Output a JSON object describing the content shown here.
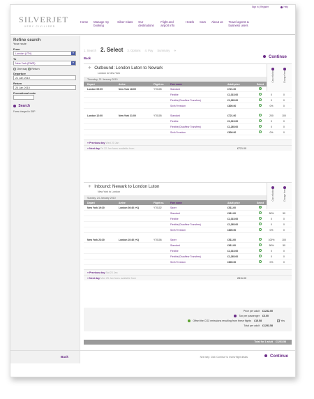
{
  "top_links": {
    "sign_in": "Sign in",
    "register": "Register",
    "help": "Help"
  },
  "logo": {
    "brand": "SILVERJET",
    "tagline": "VERY CIVILISED"
  },
  "nav": [
    "Home",
    "Manage my booking",
    "Silver Class",
    "Our destinations",
    "Flight and airport info",
    "Hotels",
    "Cars",
    "About us",
    "Travel agents & business users"
  ],
  "sidebar": {
    "title": "Refine search",
    "subtitle": "Your route",
    "from_label": "From",
    "from_value": "London (LTN)",
    "to_label": "To",
    "to_value": "New York (EWR)",
    "one_way": "One way",
    "return": "Return",
    "departure_label": "Departure",
    "departure_value": "21 Jan 2010",
    "return_label": "Return",
    "return_value": "24 Jan 2010",
    "promo_label": "Promotional code",
    "search": "Search",
    "note": "Fares charged in GBP"
  },
  "steps": [
    "1. Search",
    "2. Select",
    "3. Options",
    "4. Pay",
    "Summary"
  ],
  "back": "Back",
  "continue": "Continue",
  "columns": [
    "Depart",
    "Arrive",
    "Flight no.",
    "Fare name",
    "Adult price",
    "Select"
  ],
  "side_labels": {
    "cancellation": "Cancellation",
    "change_fees": "Change fees"
  },
  "outbound": {
    "title": "Outbound: London Luton to Newark",
    "subtitle": "London to New York",
    "date": "Thursday, 21 January 2010",
    "flights": [
      {
        "depart": "London  09:09",
        "arrive": "New York  18:09",
        "flight": "Y70105",
        "fares": [
          {
            "name": "Standard",
            "price": "£721.00",
            "selected": true,
            "cancel": "200",
            "change": "100"
          },
          {
            "name": "Flexible",
            "price": "£1,015.00",
            "selected": false,
            "cancel": "0",
            "change": "0"
          },
          {
            "name": "Flexible(Chauffeur Transfers)",
            "price": "£1,265.00",
            "selected": false,
            "cancel": "0",
            "change": "0"
          },
          {
            "name": "Sixth Freedom",
            "price": "£800.00",
            "selected": false,
            "cancel": "0%",
            "change": "0"
          }
        ]
      },
      {
        "depart": "London  12:00",
        "arrive": "New York  21:00",
        "flight": "Y70105",
        "fares": [
          {
            "name": "Standard",
            "price": "£721.00",
            "selected": false,
            "cancel": "200",
            "change": "100"
          },
          {
            "name": "Flexible",
            "price": "£1,015.00",
            "selected": false,
            "cancel": "0",
            "change": "0"
          },
          {
            "name": "Flexible(Chauffeur Transfers)",
            "price": "£1,265.00",
            "selected": false,
            "cancel": "0",
            "change": "0"
          },
          {
            "name": "Sixth Freedom",
            "price": "£800.00",
            "selected": false,
            "cancel": "0%",
            "change": "0"
          }
        ]
      }
    ],
    "prev_day": "« Previous day",
    "prev_day_date": "Wed 20 Jan",
    "next_day": "» Next day",
    "next_day_note": "Fri 22 Jan  fares available from",
    "next_day_price": "£721.00"
  },
  "inbound": {
    "title": "Inbound: Newark to London Luton",
    "subtitle": "New York to London",
    "date": "Sunday, 24 January 2010",
    "flights": [
      {
        "depart": "New York  19:30",
        "arrive": "London  06:40 (+1)",
        "flight": "Y70102",
        "fares": [
          {
            "name": "Saver",
            "price": "£511.00",
            "selected": true,
            "cancel": "100%",
            "change": "100"
          },
          {
            "name": "Standard",
            "price": "£611.00",
            "selected": false,
            "cancel": "50%",
            "change": "50"
          },
          {
            "name": "Flexible",
            "price": "£1,015.00",
            "selected": false,
            "cancel": "0",
            "change": "0"
          },
          {
            "name": "Flexible(Chauffeur Transfers)",
            "price": "£1,265.00",
            "selected": false,
            "cancel": "0",
            "change": "0"
          },
          {
            "name": "Sixth Freedom",
            "price": "£800.00",
            "selected": false,
            "cancel": "0%",
            "change": "0"
          }
        ]
      },
      {
        "depart": "New York  23:30",
        "arrive": "London  10:40 (+1)",
        "flight": "Y70106",
        "fares": [
          {
            "name": "Saver",
            "price": "£511.00",
            "selected": false,
            "cancel": "100%",
            "change": "100"
          },
          {
            "name": "Standard",
            "price": "£611.00",
            "selected": false,
            "cancel": "50%",
            "change": "50"
          },
          {
            "name": "Flexible",
            "price": "£1,015.00",
            "selected": false,
            "cancel": "0",
            "change": "0"
          },
          {
            "name": "Flexible(Chauffeur Transfers)",
            "price": "£1,265.00",
            "selected": false,
            "cancel": "0",
            "change": "0"
          },
          {
            "name": "Sixth Freedom",
            "price": "£800.00",
            "selected": false,
            "cancel": "0%",
            "change": "0"
          }
        ]
      }
    ],
    "prev_day": "« Previous day",
    "prev_day_date": "Sat 23 Jan",
    "next_day": "» Next day",
    "next_day_note": "Mon 25 Jan  fares available from",
    "next_day_price": "£511.00"
  },
  "totals": {
    "price_per_adult_label": "Price per adult",
    "price_per_adult": "£1232.00",
    "tax_label": "Tax per passenger",
    "tax": "£6.00",
    "offset_label": "Offset the CO2 emissions resulting from these flights",
    "offset": "£15.58",
    "offset_yes": "Yes",
    "total_adult_label": "Total per adult",
    "total_adult": "£1253.58",
    "total_label": "Total for 1 adult",
    "total": "£1253.58"
  },
  "footer": {
    "back": "Back",
    "next_step": "Next step: Click 'Continue' to review flight details",
    "continue": "Continue"
  }
}
